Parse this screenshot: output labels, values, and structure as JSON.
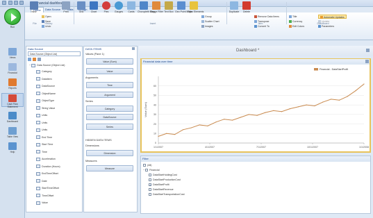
{
  "window": {
    "title": "Financial dashboard"
  },
  "ribbon": {
    "tabs": [
      "Home",
      "Data Source",
      "Data",
      "Design"
    ],
    "home": {
      "new_label": "New",
      "open_label": "Open",
      "save_label": "Save",
      "undo_label": "Undo",
      "redo_label": "Redo",
      "print_label": "Print",
      "file_group": "File",
      "history_group": "History"
    },
    "insert": {
      "items": [
        "Grid",
        "Chart",
        "Pies",
        "Gauges",
        "Cards",
        "Choropleth Map",
        "Range Filter",
        "Text Box",
        "Geo Point Maps",
        "Filter Elements"
      ],
      "group_label": "Insert"
    },
    "group_items": [
      "Group",
      "Scatter Chart",
      "Images"
    ],
    "item": {
      "duplicate_label": "Duplicate",
      "delete_label": "Delete",
      "remove_data_label": "Remove Data Items",
      "transpose_label": "Transpose",
      "convert_label": "Convert To",
      "group_label": "Item"
    },
    "dashboard": {
      "title_label": "Title",
      "currency_label": "Currency",
      "edit_colors_label": "Edit Colors",
      "auto_update_label": "Automatic Updates",
      "update_label": "Update",
      "parameters_label": "Parameters",
      "group_label": "Dashboard"
    }
  },
  "nav": {
    "run_label": "Run",
    "items": [
      "Views",
      "Financial",
      "Reports",
      "Cash Flow Statement",
      "Dashboard",
      "Table View",
      "Help"
    ]
  },
  "datasource": {
    "header": "Data Source",
    "selected": "Data Source (Object List)",
    "root": "Data Source (Object List)",
    "fields": [
      "Category",
      "DataItem",
      "DataSource",
      "ObjectName",
      "ObjectType",
      "String Value",
      "Units",
      "Units",
      "Units",
      "End Time",
      "Start Time",
      "Time",
      "Acceleration",
      "Duration (Hours)",
      "EndTimeOffset",
      "Date",
      "StartTimeOffset",
      "TimeOffset",
      "Value"
    ]
  },
  "dataitems": {
    "header": "DATA ITEMS",
    "values_label": "Values (Pane 1)",
    "value_slot": "Value (Sum)",
    "value_btn": "Value",
    "arguments_label": "Arguments",
    "argument_slot": "Time",
    "argument_btn": "Argument",
    "series_label": "Series",
    "series_slots": [
      "Category",
      "DataSource"
    ],
    "series_btn": "Series",
    "hidden_label": "HIDDEN DATA ITEMS",
    "dimensions_label": "Dimensions",
    "dimension_btn": "Dimension",
    "measures_label": "Measures",
    "measure_btn": "Measure"
  },
  "dashboard": {
    "title": "Dashboard *",
    "chart_caption": "Financial data over time",
    "filter_caption": "Filter",
    "filter": {
      "all_label": "(All)",
      "group_label": "Financial",
      "items": [
        {
          "label": "DataStartHoldingCost",
          "checked": false
        },
        {
          "label": "DataStartProductionCost",
          "checked": false
        },
        {
          "label": "DataStartProfit",
          "checked": true
        },
        {
          "label": "DataStartRevenue",
          "checked": false
        },
        {
          "label": "DataStartTransportationCost",
          "checked": false
        }
      ]
    }
  },
  "chart_data": {
    "type": "line",
    "title": "",
    "ylabel": "Value (Sum)",
    "xlabel": "",
    "legend": "Financial - DataStartProfit",
    "legend_position": "top-right",
    "series_color": "#c98a4e",
    "ylim": [
      0,
      70
    ],
    "yticks": [
      0,
      10,
      20,
      30,
      40,
      50,
      60
    ],
    "xtick_labels": [
      "1/1/2007",
      "4/1/2007",
      "7/1/2007",
      "10/1/2007",
      "1/1/2008"
    ],
    "x": [
      0,
      0.04,
      0.08,
      0.12,
      0.16,
      0.2,
      0.24,
      0.28,
      0.32,
      0.36,
      0.4,
      0.44,
      0.48,
      0.52,
      0.56,
      0.6,
      0.64,
      0.68,
      0.72,
      0.76,
      0.8,
      0.84,
      0.88,
      0.92,
      0.96,
      1.0
    ],
    "values": [
      7,
      10,
      9,
      14,
      16,
      19,
      18,
      22,
      25,
      24,
      27,
      30,
      29,
      32,
      34,
      33,
      36,
      38,
      40,
      39,
      43,
      46,
      45,
      49,
      55,
      62
    ],
    "grid": true
  }
}
